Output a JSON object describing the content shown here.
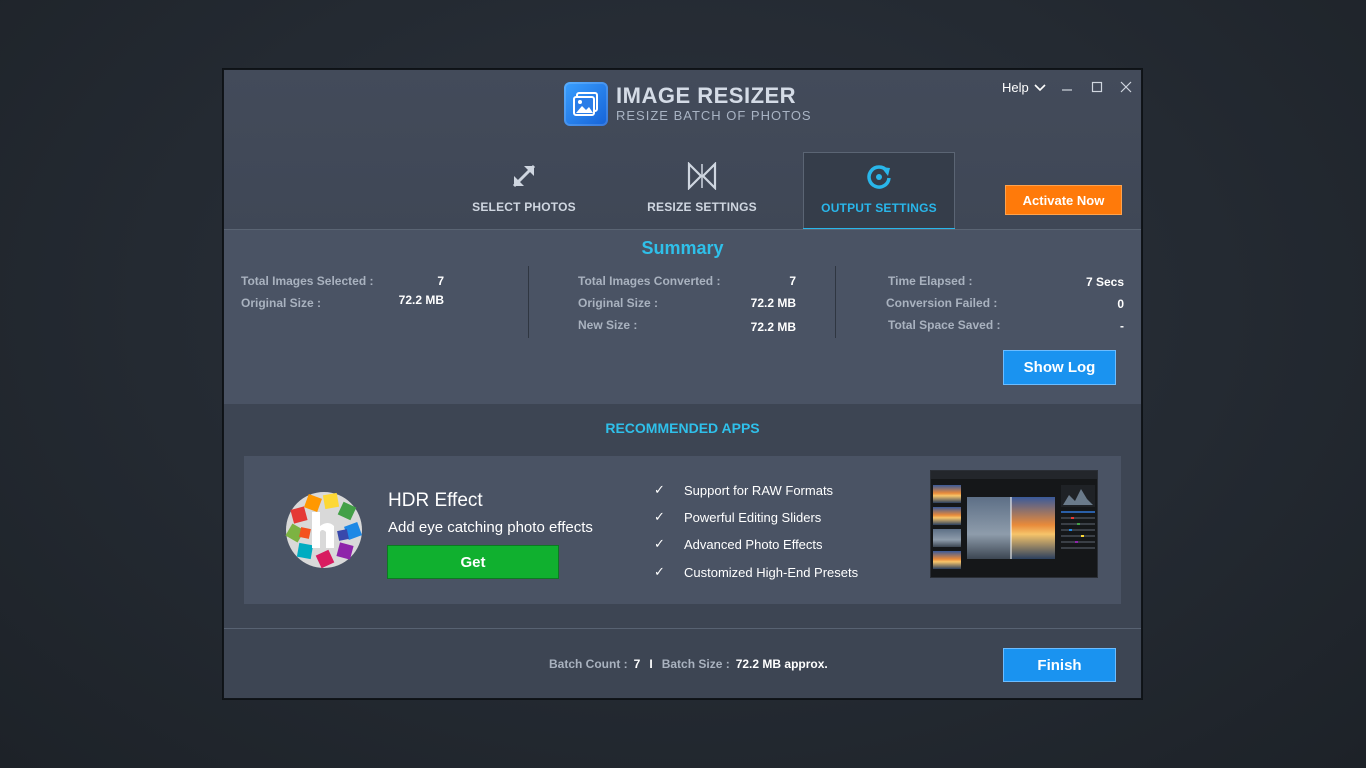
{
  "app": {
    "title": "IMAGE RESIZER",
    "subtitle": "RESIZE BATCH OF PHOTOS",
    "help_label": "Help",
    "activate_label": "Activate Now"
  },
  "tabs": [
    {
      "label": "SELECT PHOTOS",
      "icon": "expand-arrows-icon",
      "active": false
    },
    {
      "label": "RESIZE SETTINGS",
      "icon": "resize-bowtie-icon",
      "active": false
    },
    {
      "label": "OUTPUT SETTINGS",
      "icon": "refresh-icon",
      "active": true
    }
  ],
  "summary": {
    "title": "Summary",
    "col1": [
      {
        "label": "Total Images Selected :",
        "value": "7"
      },
      {
        "label": "Original Size :",
        "value": "72.2 MB"
      }
    ],
    "col2": [
      {
        "label": "Total Images Converted :",
        "value": "7"
      },
      {
        "label": "Original Size :",
        "value": "72.2 MB"
      },
      {
        "label": "New Size :",
        "value": "72.2 MB"
      }
    ],
    "col3": [
      {
        "label": "Time Elapsed :",
        "value": "7 Secs"
      },
      {
        "label": "Conversion Failed :",
        "value": "0"
      },
      {
        "label": "Total Space Saved :",
        "value": "-"
      }
    ],
    "show_log_label": "Show Log"
  },
  "recommended": {
    "title": "RECOMMENDED APPS",
    "app_name": "HDR Effect",
    "tagline": "Add eye catching photo effects",
    "get_label": "Get",
    "features": [
      "Support for RAW Formats",
      "Powerful Editing Sliders",
      "Advanced Photo Effects",
      "Customized High-End Presets"
    ]
  },
  "footer": {
    "batch_count_label": "Batch Count :",
    "batch_count_value": "7",
    "separator": "I",
    "batch_size_label": "Batch Size :",
    "batch_size_value": "72.2 MB approx.",
    "finish_label": "Finish"
  },
  "colors": {
    "accent_cyan": "#29b6ea",
    "activate_orange": "#ff7a0a",
    "primary_blue": "#1a93f0",
    "get_green": "#10b02f"
  }
}
